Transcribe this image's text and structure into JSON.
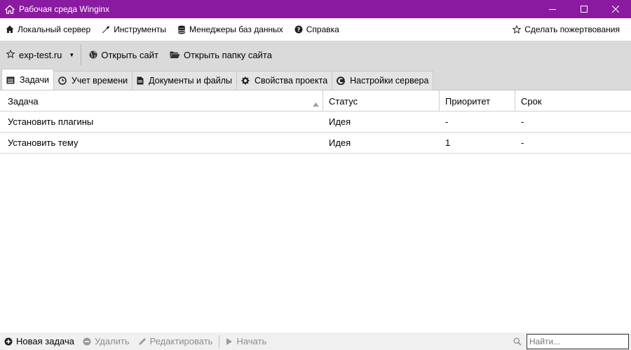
{
  "window": {
    "title": "Рабочая среда Winginx"
  },
  "menu": {
    "items": [
      {
        "label": "Локальный сервер",
        "icon": "home-icon"
      },
      {
        "label": "Инструменты",
        "icon": "wrench-icon"
      },
      {
        "label": "Менеджеры баз данных",
        "icon": "database-icon"
      },
      {
        "label": "Справка",
        "icon": "help-icon"
      }
    ],
    "donate": {
      "label": "Сделать пожертвования",
      "icon": "star-icon"
    }
  },
  "toolbar": {
    "site": "exp-test.ru",
    "open_site": "Открыть сайт",
    "open_folder": "Открыть папку сайта"
  },
  "tabs": [
    {
      "label": "Задачи",
      "icon": "calendar-icon",
      "active": true
    },
    {
      "label": "Учет времени",
      "icon": "clock-icon",
      "active": false
    },
    {
      "label": "Документы и файлы",
      "icon": "file-icon",
      "active": false
    },
    {
      "label": "Свойства проекта",
      "icon": "gear-icon",
      "active": false
    },
    {
      "label": "Настройки сервера",
      "icon": "server-icon",
      "active": false
    }
  ],
  "table": {
    "columns": [
      "Задача",
      "Статус",
      "Приоритет",
      "Срок"
    ],
    "rows": [
      [
        "Установить плагины",
        "Идея",
        "-",
        "-"
      ],
      [
        "Установить тему",
        "Идея",
        "1",
        "-"
      ]
    ]
  },
  "bottom": {
    "new_task": "Новая задача",
    "delete": "Удалить",
    "edit": "Редактировать",
    "start": "Начать",
    "search_placeholder": "Найти..."
  },
  "colors": {
    "titlebar": "#8a1a9f",
    "toolbar": "#dadada"
  }
}
